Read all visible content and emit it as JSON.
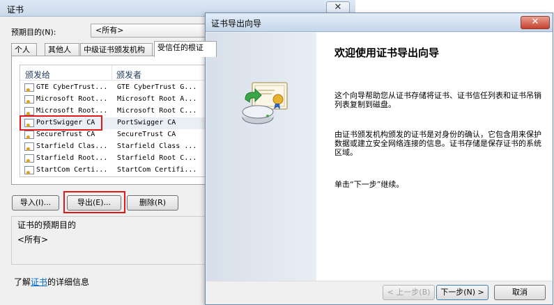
{
  "cert_manager": {
    "title": "证书",
    "close_glyph": "✕",
    "purpose_label": "预期目的(N):",
    "purpose_value": "<所有>",
    "tabs": [
      "个人",
      "其他人",
      "中级证书颁发机构",
      "受信任的根证"
    ],
    "columns": {
      "issued_to": "颁发给",
      "issued_by": "颁发者"
    },
    "rows": [
      {
        "issued_to": "GTE CyberTrust...",
        "issued_by": "GTE CyberTrust G..."
      },
      {
        "issued_to": "Microsoft Root...",
        "issued_by": "Microsoft Root A..."
      },
      {
        "issued_to": "Microsoft Root...",
        "issued_by": "Microsoft Root C..."
      },
      {
        "issued_to": "PortSwigger CA",
        "issued_by": "PortSwigger CA"
      },
      {
        "issued_to": "SecureTrust CA",
        "issued_by": "SecureTrust CA"
      },
      {
        "issued_to": "Starfield Clas...",
        "issued_by": "Starfield Class ..."
      },
      {
        "issued_to": "Starfield Root...",
        "issued_by": "Starfield Root C..."
      },
      {
        "issued_to": "StartCom Certi...",
        "issued_by": "StartCom Certifi..."
      }
    ],
    "buttons": {
      "import": "导入(I)...",
      "export": "导出(E)...",
      "remove": "删除(R)"
    },
    "purpose_group_label": "证书的预期目的",
    "purpose_group_value": "<所有>",
    "learn_prefix": "了解",
    "learn_link": "证书",
    "learn_suffix": "的详细信息"
  },
  "wizard": {
    "title": "证书导出向导",
    "close_glyph": "✕",
    "heading": "欢迎使用证书导出向导",
    "para1": "这个向导帮助您从证书存储将证书、证书信任列表和证书吊销列表复制到磁盘。",
    "para2": "由证书颁发机构颁发的证书是对身份的确认，它包含用来保护数据或建立安全网络连接的信息。证书存储是保存证书的系统区域。",
    "para3": "单击“下一步”继续。",
    "buttons": {
      "back": "< 上一步(B)",
      "next": "下一步(N) >",
      "cancel": "取消"
    }
  },
  "colors": {
    "highlight_box": "#e01818",
    "link": "#0066cc"
  },
  "icons": [
    "certificate-export-icon",
    "certificate-icon",
    "close-icon"
  ]
}
